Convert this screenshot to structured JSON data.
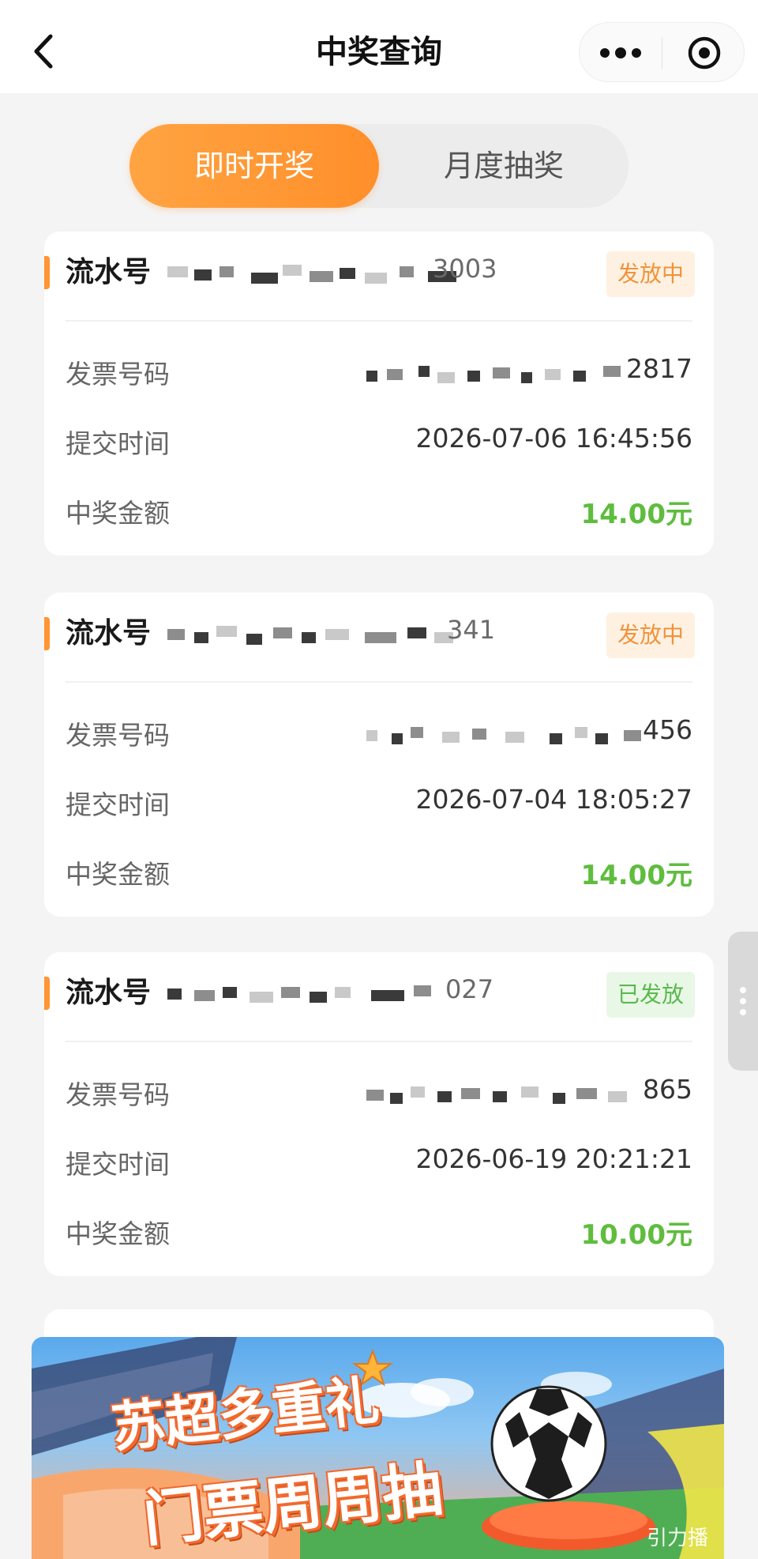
{
  "nav": {
    "title": "中奖查询",
    "back_icon": "chevron-left-icon",
    "more_icon": "more-dots-icon",
    "close_icon": "target-close-icon"
  },
  "tabs": [
    {
      "label": "即时开奖",
      "active": true
    },
    {
      "label": "月度抽奖",
      "active": false
    }
  ],
  "records": [
    {
      "serial_label": "流水号",
      "serial_tail": "3003",
      "status": "发放中",
      "status_color": "#f0933a",
      "invoice_label": "发票号码",
      "invoice_tail": "2817",
      "time_label": "提交时间",
      "time": "2026-07-06 16:45:56",
      "amount_label": "中奖金额",
      "amount": "14.00元"
    },
    {
      "serial_label": "流水号",
      "serial_tail": "341",
      "status": "发放中",
      "status_color": "#f0933a",
      "invoice_label": "发票号码",
      "invoice_tail": "456",
      "time_label": "提交时间",
      "time": "2026-07-04 18:05:27",
      "amount_label": "中奖金额",
      "amount": "14.00元"
    },
    {
      "serial_label": "流水号",
      "serial_tail": "027",
      "status": "已发放",
      "status_color": "#59b94e",
      "invoice_label": "发票号码",
      "invoice_tail": "865",
      "time_label": "提交时间",
      "time": "2026-06-19 20:21:21",
      "amount_label": "中奖金额",
      "amount": "10.00元"
    }
  ],
  "banner": {
    "line1": "苏超多重礼",
    "line2": "门票周周抽",
    "watermark": "引力播"
  },
  "colors": {
    "accent_orange": "#ff9533",
    "amount_green": "#5fbd3e",
    "status_green": "#59b94e"
  }
}
